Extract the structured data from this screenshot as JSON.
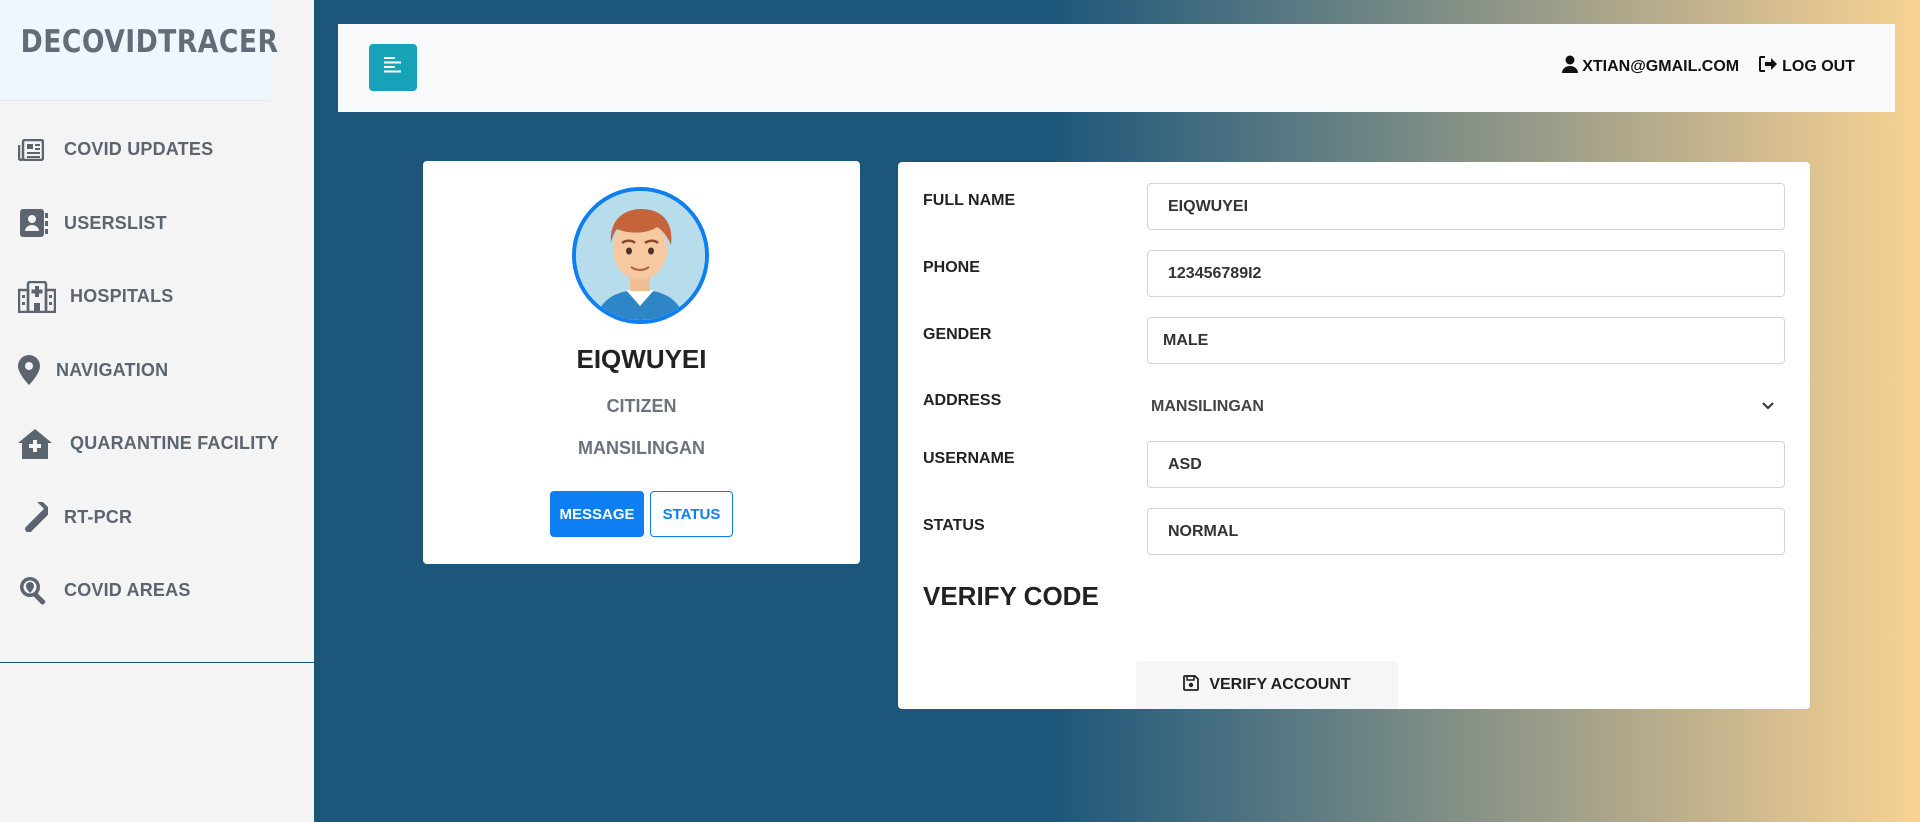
{
  "app": {
    "brand": "DECOVIDTRACER"
  },
  "sidebar": {
    "items": [
      {
        "label": "COVID UPDATES",
        "icon": "newspaper-icon"
      },
      {
        "label": "USERSLIST",
        "icon": "address-book-icon"
      },
      {
        "label": "HOSPITALS",
        "icon": "hospital-icon"
      },
      {
        "label": "NAVIGATION",
        "icon": "map-pin-icon"
      },
      {
        "label": "QUARANTINE FACILITY",
        "icon": "house-medical-icon"
      },
      {
        "label": "RT-PCR",
        "icon": "test-tube-icon"
      },
      {
        "label": "COVID AREAS",
        "icon": "search-location-icon"
      }
    ]
  },
  "topbar": {
    "user_email": "XTIAN@GMAIL.COM",
    "logout_label": "LOG OUT"
  },
  "profile": {
    "name": "EIQWUYEI",
    "role": "CITIZEN",
    "place": "MANSILINGAN",
    "message_label": "MESSAGE",
    "status_label": "STATUS"
  },
  "form": {
    "full_name_label": "FULL NAME",
    "full_name_value": "EIQWUYEI",
    "phone_label": "PHONE",
    "phone_value": "123456789I2",
    "gender_label": "GENDER",
    "gender_value": "MALE",
    "address_label": "ADDRESS",
    "address_value": "MANSILINGAN",
    "username_label": "USERNAME",
    "username_value": "ASD",
    "status_label": "STATUS",
    "status_value": "NORMAL",
    "verify_heading": "VERIFY CODE",
    "verify_button": "VERIFY ACCOUNT"
  },
  "colors": {
    "primary": "#0d7ff2",
    "toggle": "#17a2b8",
    "background": "#1c577b",
    "gradient_end": "#f8d393"
  }
}
